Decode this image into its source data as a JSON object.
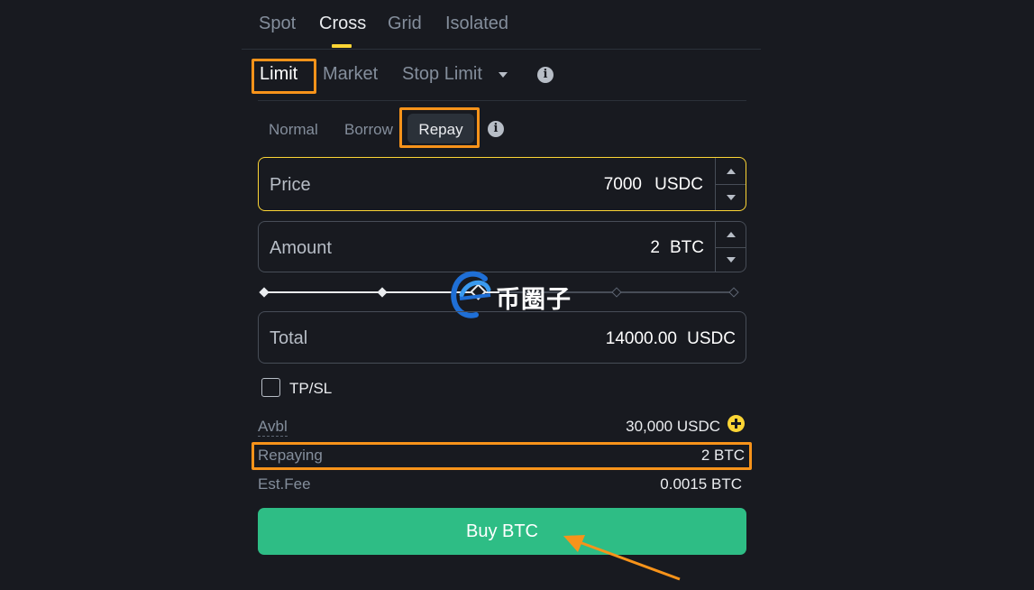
{
  "margin_tabs": [
    "Spot",
    "Cross",
    "Grid",
    "Isolated"
  ],
  "order_types": {
    "limit": "Limit",
    "market": "Market",
    "stop_limit": "Stop Limit"
  },
  "modes": {
    "normal": "Normal",
    "borrow": "Borrow",
    "repay": "Repay"
  },
  "price": {
    "label": "Price",
    "value": "7000",
    "unit": "USDC"
  },
  "amount": {
    "label": "Amount",
    "value": "2",
    "unit": "BTC"
  },
  "slider": {
    "level_fraction": 0.5
  },
  "total": {
    "label": "Total",
    "value": "14000.00",
    "unit": "USDC"
  },
  "tpsl": {
    "label": "TP/SL",
    "checked": false
  },
  "info": {
    "avbl_label": "Avbl",
    "avbl_value": "30,000 USDC",
    "repaying_label": "Repaying",
    "repaying_value": "2 BTC",
    "fee_label": "Est.Fee",
    "fee_value": "0.0015 BTC"
  },
  "buy_button": "Buy BTC",
  "watermark": "币圈子",
  "colors": {
    "background": "#181a20",
    "accent_yellow": "#fcd535",
    "buy_green": "#2ebd85",
    "highlight_orange": "#f7931a"
  }
}
